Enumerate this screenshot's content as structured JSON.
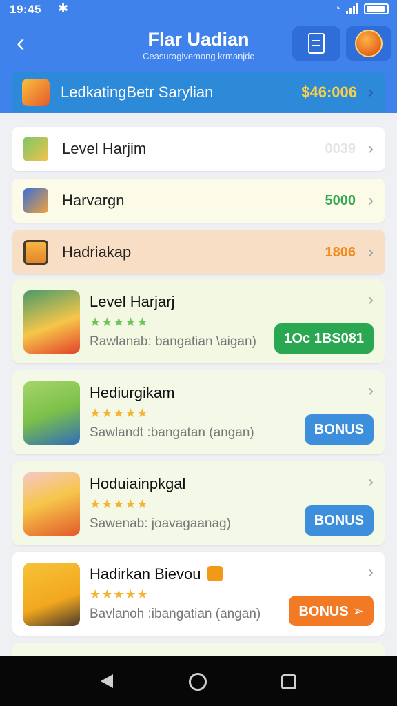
{
  "status_bar": {
    "time": "19:45",
    "bolt": "✱",
    "signal_text": "ıll",
    "battery": "battery-icon"
  },
  "header": {
    "title": "Flar Uadian",
    "subtitle": "Ceasuragivemong krmanjdc",
    "back": "‹",
    "bg_color": "#3f82ec"
  },
  "banner": {
    "label": "LedkatingBetr Sarylian",
    "amount": "$46:006",
    "chev": "›"
  },
  "rows": [
    {
      "label": "Level Harjim",
      "value": "0039",
      "value_color": "#e4e4e4",
      "bg": "#ffffff",
      "icon": "pencil-icon",
      "chev": "›"
    },
    {
      "label": "Harvargn",
      "value": "5000",
      "value_color": "#34a853",
      "bg": "#fbfbe8",
      "icon": "map-icon",
      "chev": "›"
    },
    {
      "label": "Hadriakap",
      "value": "1806",
      "value_color": "#f08a1c",
      "bg": "#f7dec5",
      "icon": "jar-icon",
      "chev": "›"
    }
  ],
  "cards": [
    {
      "title": "Level Harjarj",
      "stars": "★★★★★",
      "star_color": "#6ec45a",
      "desc": "Rawlanab: bangatian \\aigan)",
      "button": "1Oc 1BS081",
      "button_color": "#29a851",
      "bg": "#f2f8e2",
      "icon": "fruit-bucket-icon",
      "chev": "›"
    },
    {
      "title": "Hediurgikam",
      "stars": "★★★★★",
      "star_color": "#f3b530",
      "desc": "Sawlandt :bangatan (angan)",
      "button": "BONUS",
      "button_color": "#3d8fdc",
      "bg": "#f4f8e6",
      "icon": "man-avatar-icon",
      "chev": "›"
    },
    {
      "title": "Hoduiainpkgal",
      "stars": "★★★★★",
      "star_color": "#f3b530",
      "desc": "Sawenab: joavagaanag)",
      "button": "BONUS",
      "button_color": "#3d8fdc",
      "bg": "#f4f8e6",
      "icon": "gift-box-icon",
      "chev": "›"
    },
    {
      "title": "Hadirkan Bievou",
      "stars": "★★★★★",
      "star_color": "#f3b530",
      "desc": "Bavlanoh :ibangatian (angan)",
      "button": "BONUS ➢",
      "button_color": "#f27a25",
      "bg": "#ffffff",
      "icon": "terminal-icon",
      "chev": "›"
    }
  ],
  "nav": {
    "back": "nav-back-icon",
    "home": "nav-home-icon",
    "recent": "nav-recent-icon"
  }
}
